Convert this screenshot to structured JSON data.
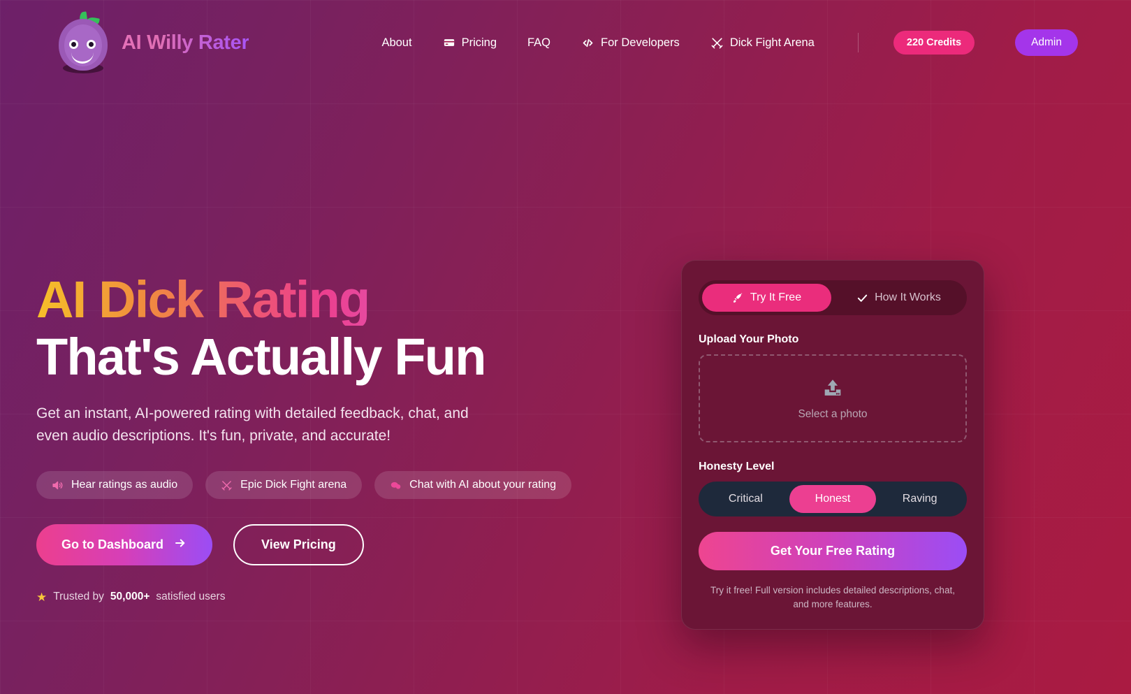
{
  "brand": {
    "name": "AI Willy Rater",
    "logo_icon": "plum-mascot-icon"
  },
  "nav": {
    "links": [
      {
        "label": "About",
        "icon": ""
      },
      {
        "label": "Pricing",
        "icon": "credit-card-icon"
      },
      {
        "label": "FAQ",
        "icon": ""
      },
      {
        "label": "For Developers",
        "icon": "code-brackets-icon"
      },
      {
        "label": "Dick Fight Arena",
        "icon": "crossed-swords-icon"
      }
    ],
    "credits_badge": "220 Credits",
    "admin_label": "Admin"
  },
  "hero": {
    "title_line1": "AI Dick Rating",
    "title_line2": "That's Actually Fun",
    "subtitle": "Get an instant, AI-powered rating with detailed feedback, chat, and even audio descriptions. It's fun, private, and accurate!",
    "pills": [
      {
        "label": "Hear ratings as audio",
        "icon": "speaker-icon"
      },
      {
        "label": "Epic Dick Fight arena",
        "icon": "crossed-swords-icon"
      },
      {
        "label": "Chat with AI about your rating",
        "icon": "chat-bubble-icon"
      }
    ],
    "primary_cta": "Go to Dashboard",
    "primary_cta_icon": "arrow-right-icon",
    "secondary_cta": "View Pricing",
    "trust_prefix": "Trusted by",
    "trust_count": "50,000+",
    "trust_suffix": "satisfied users",
    "trust_icon": "star-icon"
  },
  "card": {
    "tabs": [
      {
        "label": "Try It Free",
        "icon": "rocket-icon",
        "active": true
      },
      {
        "label": "How It Works",
        "icon": "check-icon",
        "active": false
      }
    ],
    "upload_label": "Upload Your Photo",
    "upload_placeholder": "Select a photo",
    "upload_icon": "upload-tray-icon",
    "honesty_label": "Honesty Level",
    "honesty_options": [
      {
        "label": "Critical",
        "active": false
      },
      {
        "label": "Honest",
        "active": true
      },
      {
        "label": "Raving",
        "active": false
      }
    ],
    "submit_label": "Get Your Free Rating",
    "note": "Try it free! Full version includes detailed descriptions, chat, and more features."
  },
  "colors": {
    "accent_pink": "#ec2a7b",
    "accent_purple": "#a435ea",
    "card_bg": "#6b1536",
    "segment_track": "#1e293b",
    "star_yellow": "#f8c63a"
  }
}
